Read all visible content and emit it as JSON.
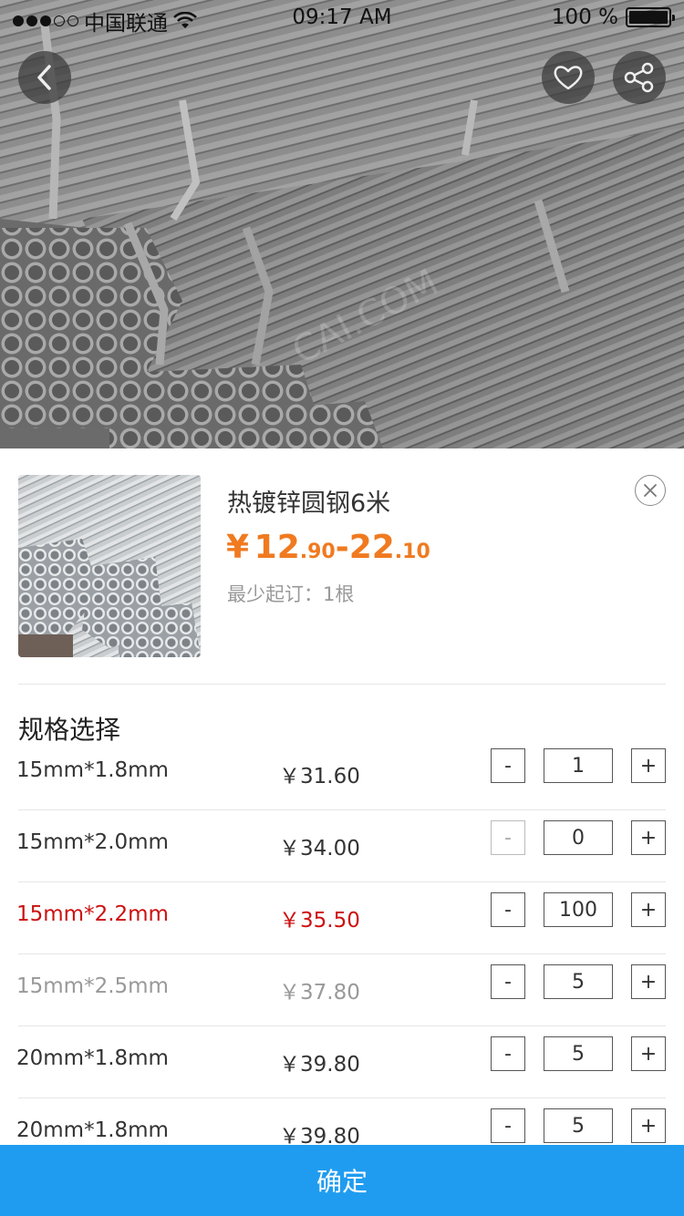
{
  "status_bar": {
    "carrier": "中国联通",
    "time": "09:17 AM",
    "battery": "100 %"
  },
  "hero": {
    "icons": {
      "back": "chevron-left-icon",
      "favorite": "heart-icon",
      "share": "share-icon"
    },
    "watermark": "CAI.COM"
  },
  "product": {
    "title": "热镀锌圆钢6米",
    "price_symbol": "¥",
    "price_low_int": "12",
    "price_low_dec": ".90",
    "price_dash": "-",
    "price_high_int": "22",
    "price_high_dec": ".10",
    "moq": "最少起订：1根"
  },
  "specs": {
    "heading": "规格选择",
    "rows": [
      {
        "size": "15mm*1.8mm",
        "price": "￥31.60",
        "qty": "1",
        "state": "normal",
        "minus_disabled": false
      },
      {
        "size": "15mm*2.0mm",
        "price": "￥34.00",
        "qty": "0",
        "state": "normal",
        "minus_disabled": true
      },
      {
        "size": "15mm*2.2mm",
        "price": "￥35.50",
        "qty": "100",
        "state": "selected",
        "minus_disabled": false
      },
      {
        "size": "15mm*2.5mm",
        "price": "￥37.80",
        "qty": "5",
        "state": "disabled",
        "minus_disabled": false
      },
      {
        "size": "20mm*1.8mm",
        "price": "￥39.80",
        "qty": "5",
        "state": "normal",
        "minus_disabled": false
      },
      {
        "size": "20mm*1.8mm",
        "price": "￥39.80",
        "qty": "5",
        "state": "normal",
        "minus_disabled": false
      }
    ],
    "minus_label": "-",
    "plus_label": "+"
  },
  "confirm_button": {
    "label": "确定"
  },
  "colors": {
    "accent_blue": "#1f9cf0",
    "price_orange": "#f07a20",
    "selected_red": "#cc1111",
    "disabled_gray": "#999999"
  }
}
